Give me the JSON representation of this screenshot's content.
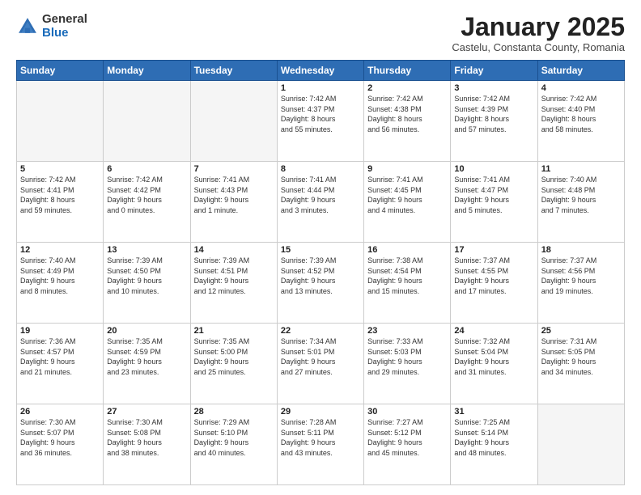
{
  "logo": {
    "general": "General",
    "blue": "Blue"
  },
  "header": {
    "month": "January 2025",
    "location": "Castelu, Constanta County, Romania"
  },
  "weekdays": [
    "Sunday",
    "Monday",
    "Tuesday",
    "Wednesday",
    "Thursday",
    "Friday",
    "Saturday"
  ],
  "weeks": [
    [
      {
        "day": "",
        "info": ""
      },
      {
        "day": "",
        "info": ""
      },
      {
        "day": "",
        "info": ""
      },
      {
        "day": "1",
        "info": "Sunrise: 7:42 AM\nSunset: 4:37 PM\nDaylight: 8 hours\nand 55 minutes."
      },
      {
        "day": "2",
        "info": "Sunrise: 7:42 AM\nSunset: 4:38 PM\nDaylight: 8 hours\nand 56 minutes."
      },
      {
        "day": "3",
        "info": "Sunrise: 7:42 AM\nSunset: 4:39 PM\nDaylight: 8 hours\nand 57 minutes."
      },
      {
        "day": "4",
        "info": "Sunrise: 7:42 AM\nSunset: 4:40 PM\nDaylight: 8 hours\nand 58 minutes."
      }
    ],
    [
      {
        "day": "5",
        "info": "Sunrise: 7:42 AM\nSunset: 4:41 PM\nDaylight: 8 hours\nand 59 minutes."
      },
      {
        "day": "6",
        "info": "Sunrise: 7:42 AM\nSunset: 4:42 PM\nDaylight: 9 hours\nand 0 minutes."
      },
      {
        "day": "7",
        "info": "Sunrise: 7:41 AM\nSunset: 4:43 PM\nDaylight: 9 hours\nand 1 minute."
      },
      {
        "day": "8",
        "info": "Sunrise: 7:41 AM\nSunset: 4:44 PM\nDaylight: 9 hours\nand 3 minutes."
      },
      {
        "day": "9",
        "info": "Sunrise: 7:41 AM\nSunset: 4:45 PM\nDaylight: 9 hours\nand 4 minutes."
      },
      {
        "day": "10",
        "info": "Sunrise: 7:41 AM\nSunset: 4:47 PM\nDaylight: 9 hours\nand 5 minutes."
      },
      {
        "day": "11",
        "info": "Sunrise: 7:40 AM\nSunset: 4:48 PM\nDaylight: 9 hours\nand 7 minutes."
      }
    ],
    [
      {
        "day": "12",
        "info": "Sunrise: 7:40 AM\nSunset: 4:49 PM\nDaylight: 9 hours\nand 8 minutes."
      },
      {
        "day": "13",
        "info": "Sunrise: 7:39 AM\nSunset: 4:50 PM\nDaylight: 9 hours\nand 10 minutes."
      },
      {
        "day": "14",
        "info": "Sunrise: 7:39 AM\nSunset: 4:51 PM\nDaylight: 9 hours\nand 12 minutes."
      },
      {
        "day": "15",
        "info": "Sunrise: 7:39 AM\nSunset: 4:52 PM\nDaylight: 9 hours\nand 13 minutes."
      },
      {
        "day": "16",
        "info": "Sunrise: 7:38 AM\nSunset: 4:54 PM\nDaylight: 9 hours\nand 15 minutes."
      },
      {
        "day": "17",
        "info": "Sunrise: 7:37 AM\nSunset: 4:55 PM\nDaylight: 9 hours\nand 17 minutes."
      },
      {
        "day": "18",
        "info": "Sunrise: 7:37 AM\nSunset: 4:56 PM\nDaylight: 9 hours\nand 19 minutes."
      }
    ],
    [
      {
        "day": "19",
        "info": "Sunrise: 7:36 AM\nSunset: 4:57 PM\nDaylight: 9 hours\nand 21 minutes."
      },
      {
        "day": "20",
        "info": "Sunrise: 7:35 AM\nSunset: 4:59 PM\nDaylight: 9 hours\nand 23 minutes."
      },
      {
        "day": "21",
        "info": "Sunrise: 7:35 AM\nSunset: 5:00 PM\nDaylight: 9 hours\nand 25 minutes."
      },
      {
        "day": "22",
        "info": "Sunrise: 7:34 AM\nSunset: 5:01 PM\nDaylight: 9 hours\nand 27 minutes."
      },
      {
        "day": "23",
        "info": "Sunrise: 7:33 AM\nSunset: 5:03 PM\nDaylight: 9 hours\nand 29 minutes."
      },
      {
        "day": "24",
        "info": "Sunrise: 7:32 AM\nSunset: 5:04 PM\nDaylight: 9 hours\nand 31 minutes."
      },
      {
        "day": "25",
        "info": "Sunrise: 7:31 AM\nSunset: 5:05 PM\nDaylight: 9 hours\nand 34 minutes."
      }
    ],
    [
      {
        "day": "26",
        "info": "Sunrise: 7:30 AM\nSunset: 5:07 PM\nDaylight: 9 hours\nand 36 minutes."
      },
      {
        "day": "27",
        "info": "Sunrise: 7:30 AM\nSunset: 5:08 PM\nDaylight: 9 hours\nand 38 minutes."
      },
      {
        "day": "28",
        "info": "Sunrise: 7:29 AM\nSunset: 5:10 PM\nDaylight: 9 hours\nand 40 minutes."
      },
      {
        "day": "29",
        "info": "Sunrise: 7:28 AM\nSunset: 5:11 PM\nDaylight: 9 hours\nand 43 minutes."
      },
      {
        "day": "30",
        "info": "Sunrise: 7:27 AM\nSunset: 5:12 PM\nDaylight: 9 hours\nand 45 minutes."
      },
      {
        "day": "31",
        "info": "Sunrise: 7:25 AM\nSunset: 5:14 PM\nDaylight: 9 hours\nand 48 minutes."
      },
      {
        "day": "",
        "info": ""
      }
    ]
  ]
}
